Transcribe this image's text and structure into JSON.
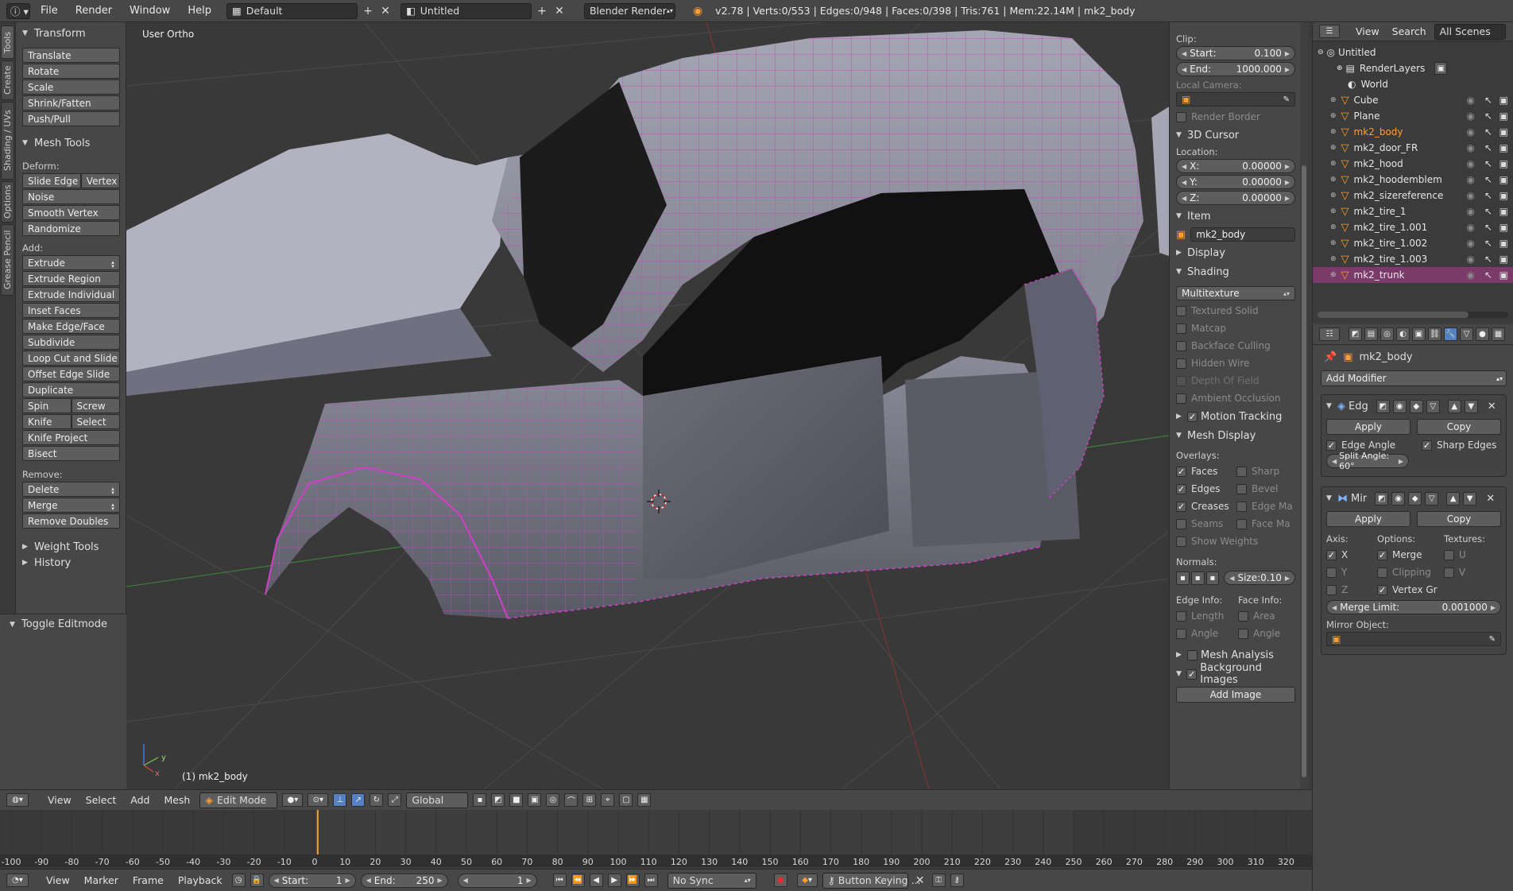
{
  "topbar": {
    "menus": [
      "File",
      "Render",
      "Window",
      "Help"
    ],
    "layout": "Default",
    "scene": "Untitled",
    "engine": "Blender Render",
    "stats": "v2.78 | Verts:0/553 | Edges:0/948 | Faces:0/398 | Tris:761 | Mem:22.14M | mk2_body"
  },
  "side_tabs": [
    "Tools",
    "Create",
    "Shading / UVs",
    "Options",
    "Grease Pencil"
  ],
  "toolshelf": {
    "transform": {
      "title": "Transform",
      "buttons": [
        "Translate",
        "Rotate",
        "Scale",
        "Shrink/Fatten",
        "Push/Pull"
      ]
    },
    "mesh_tools": {
      "title": "Mesh Tools",
      "deform_label": "Deform:",
      "slide_edge": "Slide Edge",
      "vertex": "Vertex",
      "noise": "Noise",
      "smooth_vertex": "Smooth Vertex",
      "randomize": "Randomize",
      "add_label": "Add:",
      "extrude": "Extrude",
      "add_buttons": [
        "Extrude Region",
        "Extrude Individual",
        "Inset Faces",
        "Make Edge/Face",
        "Subdivide",
        "Loop Cut and Slide",
        "Offset Edge Slide",
        "Duplicate"
      ],
      "spin": "Spin",
      "screw": "Screw",
      "knife": "Knife",
      "select": "Select",
      "knife_project": "Knife Project",
      "bisect": "Bisect",
      "remove_label": "Remove:",
      "delete": "Delete",
      "merge": "Merge",
      "remove_doubles": "Remove Doubles"
    },
    "weight_tools": "Weight Tools",
    "history": "History",
    "toggle_editmode": "Toggle Editmode"
  },
  "viewport": {
    "view_name": "User Ortho",
    "object_label": "(1) mk2_body",
    "axis_y": "y",
    "axis_x": "x"
  },
  "npanel": {
    "clip_label": "Clip:",
    "clip_start_label": "Start:",
    "clip_start": "0.100",
    "clip_end_label": "End:",
    "clip_end": "1000.000",
    "local_camera_label": "Local Camera:",
    "render_border": "Render Border",
    "cursor_title": "3D Cursor",
    "location_label": "Location:",
    "x_label": "X:",
    "x_val": "0.00000",
    "y_label": "Y:",
    "y_val": "0.00000",
    "z_label": "Z:",
    "z_val": "0.00000",
    "item_title": "Item",
    "item_name": "mk2_body",
    "display_title": "Display",
    "shading_title": "Shading",
    "shading_mode": "Multitexture",
    "shading_opts": [
      "Textured Solid",
      "Matcap",
      "Backface Culling",
      "Hidden Wire",
      "Depth Of Field",
      "Ambient Occlusion"
    ],
    "motion_tracking": "Motion Tracking",
    "mesh_display_title": "Mesh Display",
    "overlays_label": "Overlays:",
    "faces": "Faces",
    "sharp": "Sharp",
    "edges": "Edges",
    "bevel": "Bevel",
    "creases": "Creases",
    "edge_marks": "Edge Ma",
    "seams": "Seams",
    "face_marks": "Face Ma",
    "show_weights": "Show Weights",
    "normals_label": "Normals:",
    "size_label": "Size:",
    "size_val": "0.10",
    "edge_info_label": "Edge Info:",
    "face_info_label": "Face Info:",
    "length": "Length",
    "area": "Area",
    "angle": "Angle",
    "angle2": "Angle",
    "mesh_analysis": "Mesh Analysis",
    "background_images": "Background Images",
    "add_image": "Add Image"
  },
  "outliner": {
    "view": "View",
    "search": "Search",
    "scenes": "All Scenes",
    "scene_name": "Untitled",
    "render_layers": "RenderLayers",
    "world": "World",
    "objects": [
      "Cube",
      "Plane",
      "mk2_body",
      "mk2_door_FR",
      "mk2_hood",
      "mk2_hoodemblem",
      "mk2_sizereference",
      "mk2_tire_1",
      "mk2_tire_1.001",
      "mk2_tire_1.002",
      "mk2_tire_1.003",
      "mk2_trunk"
    ],
    "active_color": "#ff9d2e",
    "selected_bg": "#7a3b6a"
  },
  "properties": {
    "object_name": "mk2_body",
    "add_modifier": "Add Modifier",
    "edge_split": {
      "name": "Edg",
      "apply": "Apply",
      "copy": "Copy",
      "edge_angle": "Edge Angle",
      "sharp_edges": "Sharp Edges",
      "split_angle": "Split Angle: 60°"
    },
    "mirror": {
      "name": "Mir",
      "apply": "Apply",
      "copy": "Copy",
      "axis_label": "Axis:",
      "options_label": "Options:",
      "textures_label": "Textures:",
      "x": "X",
      "y": "Y",
      "z": "Z",
      "merge": "Merge",
      "clipping": "Clipping",
      "vertex_groups": "Vertex Gr",
      "u": "U",
      "v": "V",
      "merge_limit_label": "Merge Limit:",
      "merge_limit": "0.001000",
      "mirror_object_label": "Mirror Object:"
    }
  },
  "viewport_header": {
    "view": "View",
    "select": "Select",
    "add": "Add",
    "mesh": "Mesh",
    "mode": "Edit Mode",
    "orientation": "Global"
  },
  "timeline": {
    "ticks": [
      "-100",
      "-90",
      "-80",
      "-70",
      "-60",
      "-50",
      "-40",
      "-30",
      "-20",
      "-10",
      "0",
      "10",
      "20",
      "30",
      "40",
      "50",
      "60",
      "70",
      "80",
      "90",
      "100",
      "110",
      "120",
      "130",
      "140",
      "150",
      "160",
      "170",
      "180",
      "190",
      "200",
      "210",
      "220",
      "230",
      "240",
      "250",
      "260",
      "270",
      "280",
      "290",
      "300",
      "310",
      "320"
    ],
    "current_frame_marker": 1
  },
  "timeline_header": {
    "view": "View",
    "marker": "Marker",
    "frame": "Frame",
    "playback": "Playback",
    "start_label": "Start:",
    "start": "1",
    "end_label": "End:",
    "end": "250",
    "current": "1",
    "sync": "No Sync",
    "keying": "Button Keying ..."
  }
}
